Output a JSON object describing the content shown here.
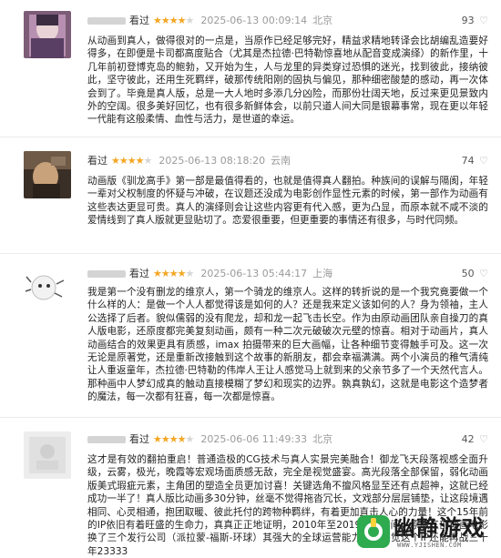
{
  "reviews": [
    {
      "watched": "看过",
      "rating": 4,
      "time": "2025-06-13 00:09:14",
      "location": "北京",
      "likes": "93",
      "heart": "♡",
      "text": "从动画到真人，做得很对的一点是，当原作已经足够完好，精益求精地转译会比胡编乱造要好得多，在即便是卡司都高度贴合（尤其是杰拉德·巴特勒惊喜地从配音变成演绎）的新作里，十几年前初登博克岛的鲍勃，又开始为生，人与龙里的异类穿过恐惧的迷光，找到彼此，接纳彼此，坚守彼此，还用生死羁绊，破那传统阳刚的固执与偏见，那种细密酸楚的感动，再一次体会到了。毕竟是真人版，总是一大人地时多添几分凶险，而那份壮阔天地，反过来更见景致内外的空阔。很多美好回忆，也有很多新鲜体会，以前只道人间大同是银幕事常，现在更以年轻一代能有这般柔情、血性与活力，是世道的幸运。"
    },
    {
      "watched": "看过",
      "rating": 4,
      "time": "2025-06-13 08:18:20",
      "location": "云南",
      "likes": "74",
      "heart": "♡",
      "text": "动画版《驯龙高手》第一部是最值得看的，也就是值得真人翻拍。种族间的误解与隔阂，年轻一辈对父权制度的怀疑与冲破，在议题还没成为电影创作显性元素的时候，第一部作为动画有这些表达更显可贵。真人的演绎则会让这些内容更有代入感，更为凸显，而原本就不咸不淡的爱情线到了真人版就更显贴切了。恋爱很重要，但更重要的事情还有很多，与时代同频。"
    },
    {
      "watched": "看过",
      "rating": 4,
      "time": "2025-06-13 05:44:17",
      "location": "上海",
      "likes": "50",
      "heart": "♡",
      "text": "我是第一个没有删龙的维京人，第一个骑龙的维京人。这样的转折说的是一个我究竟要做一个什么样的人：是做一个人人都觉得该是如何的人？还是我来定义该如何的人？身为领袖，主人公选择了后者。貌似儒弱的没有爬龙，却和龙一起飞击长空。作为由原动画团队亲自操刀的真人版电影，还原度都完美复刻动画，颇有一种二次元破破次元壁的惊喜。相对于动画片，真人动画结合的效果更具有质感，imax 拍摄带来的巨大画幅，让各种细节变得触手可及。这一次无论是原著党，还是重新改接触到这个故事的新朋友，都会幸福满满。两个小演员的稚气清纯让人重返童年，杰拉德·巴特勒的伟岸人王让人感觉马上就到来的父亲节多了一个天然代言人。那种画中人梦幻成真的触动直接模糊了梦幻和现实的边界。孰真孰幻，这就是电影这个造梦者的魔法，每一次都有狂喜，每一次都是惊喜。"
    },
    {
      "watched": "看过",
      "rating": 4,
      "time": "2025-06-06 11:49:33",
      "location": "北京",
      "likes": "42",
      "heart": "♡",
      "text": "这才是有效的翻拍重启！普通造极的CG技术与真人实景完美融合！御龙飞天段落视感全面升级，云雾，极光，晚霞等宏观场面质感无敌，完全是视觉盛宴。高光段落全部保留，弱化动画版美式瑕疵元素，主角团的塑造全员更加讨喜！关键选角不擅风格显至还有点超神，这就已经成功一半了！真人版比动画多30分钟，丝毫不觉得拖沓冗长，文戏部分层层铺垫，让这段境遇相同、心灵相通，抱团取暖、彼此托付的跨物种羁绊，有着更加直击人心的力量！这个15年前的IP依旧有着旺盛的生命力，真真正正地证明，2010年至2019这十年间，原版三部动画电影换了三个发行公司（派拉蒙-福斯-环球）其强大的全球运营能力下，感觉这个IP还能再战三十年23333"
    }
  ],
  "watermark": {
    "brand": "幽静游戏",
    "url": "WWW.YJISHEN.COM"
  },
  "colors": {
    "star_on": "#f5a623",
    "star_off": "#d6d6d6",
    "meta": "#9a9a9a"
  }
}
